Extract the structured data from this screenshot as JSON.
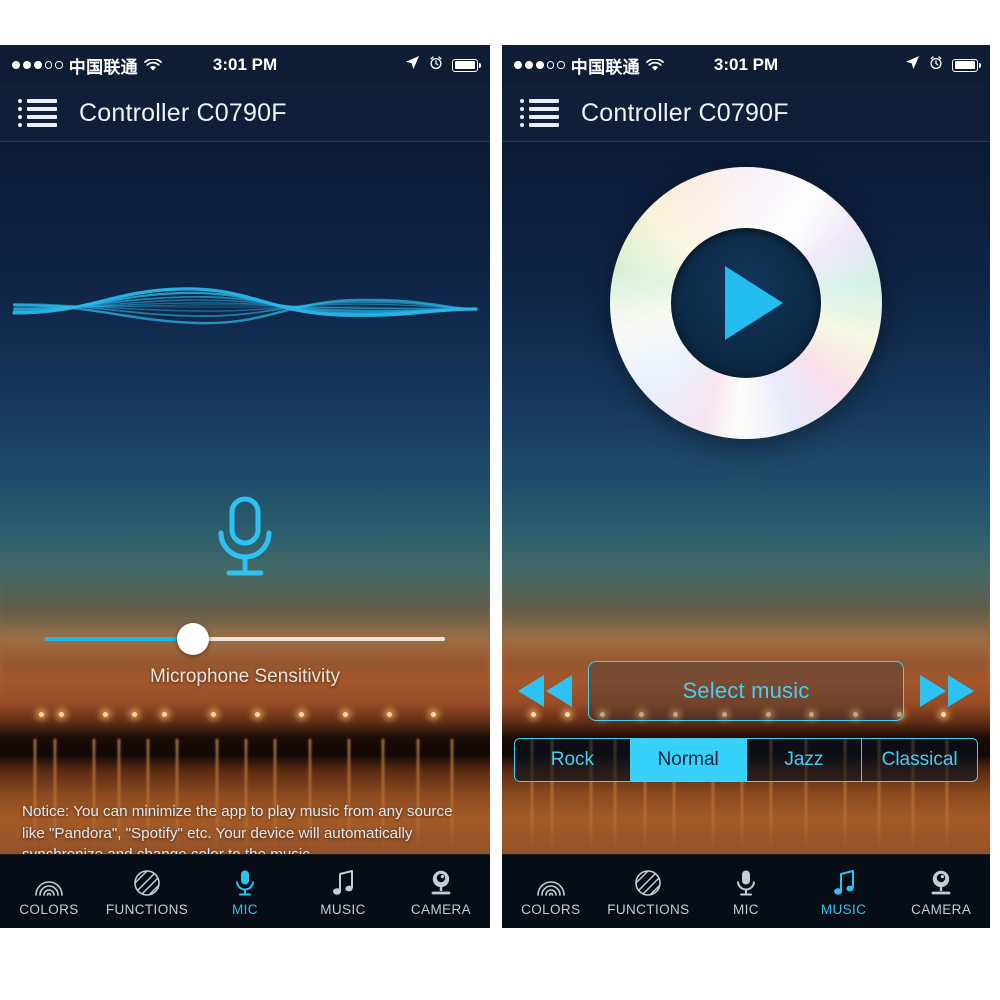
{
  "status_bar": {
    "signal_dots_filled": 3,
    "signal_dots_total": 5,
    "carrier": "中国联通",
    "time": "3:01 PM",
    "icons": [
      "location-arrow-icon",
      "alarm-clock-icon",
      "battery-icon"
    ]
  },
  "app_header": {
    "title": "Controller C0790F",
    "menu_icon": "list-menu-icon"
  },
  "colors": {
    "accent_cyan": "#2ec2f3",
    "segment_active_bg": "#36d2fb",
    "slider_fill": "#19b9e8",
    "header_bg": "#101f38",
    "tabbar_bg": "#070d17",
    "sky_top": "#0b1b35",
    "sunset_horizon": "#b4602f"
  },
  "mic_screen": {
    "waveform_label": "audio-waveform-visualizer",
    "mic_icon": "microphone-icon",
    "slider": {
      "label": "Microphone Sensitivity",
      "value_percent": 37
    },
    "notice": "Notice: You can minimize the app to play music from any source like \"Pandora\", \"Spotify\" etc. Your device will automatically synchronize and change color to the music."
  },
  "music_screen": {
    "disc": {
      "name": "cd-disc",
      "play_icon": "play-icon"
    },
    "transport": {
      "previous_label": "rewind-icon",
      "next_label": "fast-forward-icon",
      "select_music_label": "Select music"
    },
    "equalizer": {
      "options": [
        "Rock",
        "Normal",
        "Jazz",
        "Classical"
      ],
      "selected": "Normal",
      "selected_index": 1
    }
  },
  "tab_bar": {
    "items": [
      {
        "label": "COLORS",
        "icon": "rainbow-icon"
      },
      {
        "label": "FUNCTIONS",
        "icon": "striped-circle-icon"
      },
      {
        "label": "MIC",
        "icon": "microphone-icon"
      },
      {
        "label": "MUSIC",
        "icon": "music-note-icon"
      },
      {
        "label": "CAMERA",
        "icon": "webcam-icon"
      }
    ],
    "active_left": "MIC",
    "active_right": "MUSIC"
  }
}
